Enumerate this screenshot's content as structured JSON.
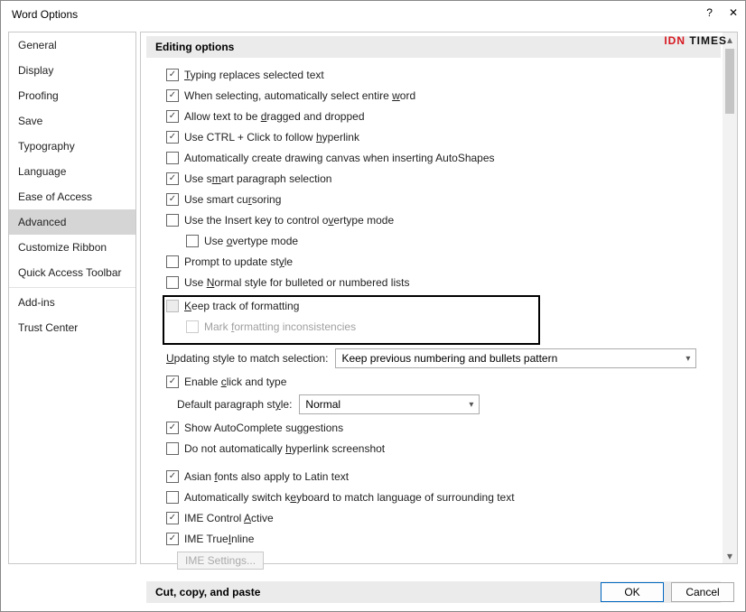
{
  "title": "Word Options",
  "watermark": {
    "part1": "IDN",
    "part2": " TIMES"
  },
  "sidebar": {
    "items": [
      {
        "label": "General"
      },
      {
        "label": "Display"
      },
      {
        "label": "Proofing"
      },
      {
        "label": "Save"
      },
      {
        "label": "Typography"
      },
      {
        "label": "Language"
      },
      {
        "label": "Ease of Access"
      },
      {
        "label": "Advanced"
      },
      {
        "label": "Customize Ribbon"
      },
      {
        "label": "Quick Access Toolbar"
      },
      {
        "label": "Add-ins"
      },
      {
        "label": "Trust Center"
      }
    ],
    "selected": "Advanced"
  },
  "sections": {
    "editing_header": "Editing options",
    "cut_header": "Cut, copy, and paste"
  },
  "options": {
    "typing_replace": "Typing replaces selected text",
    "select_entire_word": "When selecting, automatically select entire word",
    "drag_drop": "Allow text to be dragged and dropped",
    "ctrl_click": "Use CTRL + Click to follow hyperlink",
    "auto_canvas": "Automatically create drawing canvas when inserting AutoShapes",
    "smart_para": "Use smart paragraph selection",
    "smart_cursor": "Use smart cursoring",
    "insert_overtype": "Use the Insert key to control overtype mode",
    "overtype": "Use overtype mode",
    "prompt_update": "Prompt to update style",
    "use_normal": "Use Normal style for bulleted or numbered lists",
    "keep_track": "Keep track of formatting",
    "mark_inconsistencies": "Mark formatting inconsistencies",
    "updating_label": "Updating style to match selection:",
    "updating_value": "Keep previous numbering and bullets pattern",
    "enable_click": "Enable click and type",
    "default_para_label": "Default paragraph style:",
    "default_para_value": "Normal",
    "autocomplete": "Show AutoComplete suggestions",
    "no_auto_hyperlink": "Do not automatically hyperlink screenshot",
    "asian_fonts": "Asian fonts also apply to Latin text",
    "auto_keyboard": "Automatically switch keyboard to match language of surrounding text",
    "ime_active": "IME Control Active",
    "ime_trueinline": "IME TrueInline",
    "ime_settings": "IME Settings..."
  },
  "buttons": {
    "ok": "OK",
    "cancel": "Cancel"
  }
}
